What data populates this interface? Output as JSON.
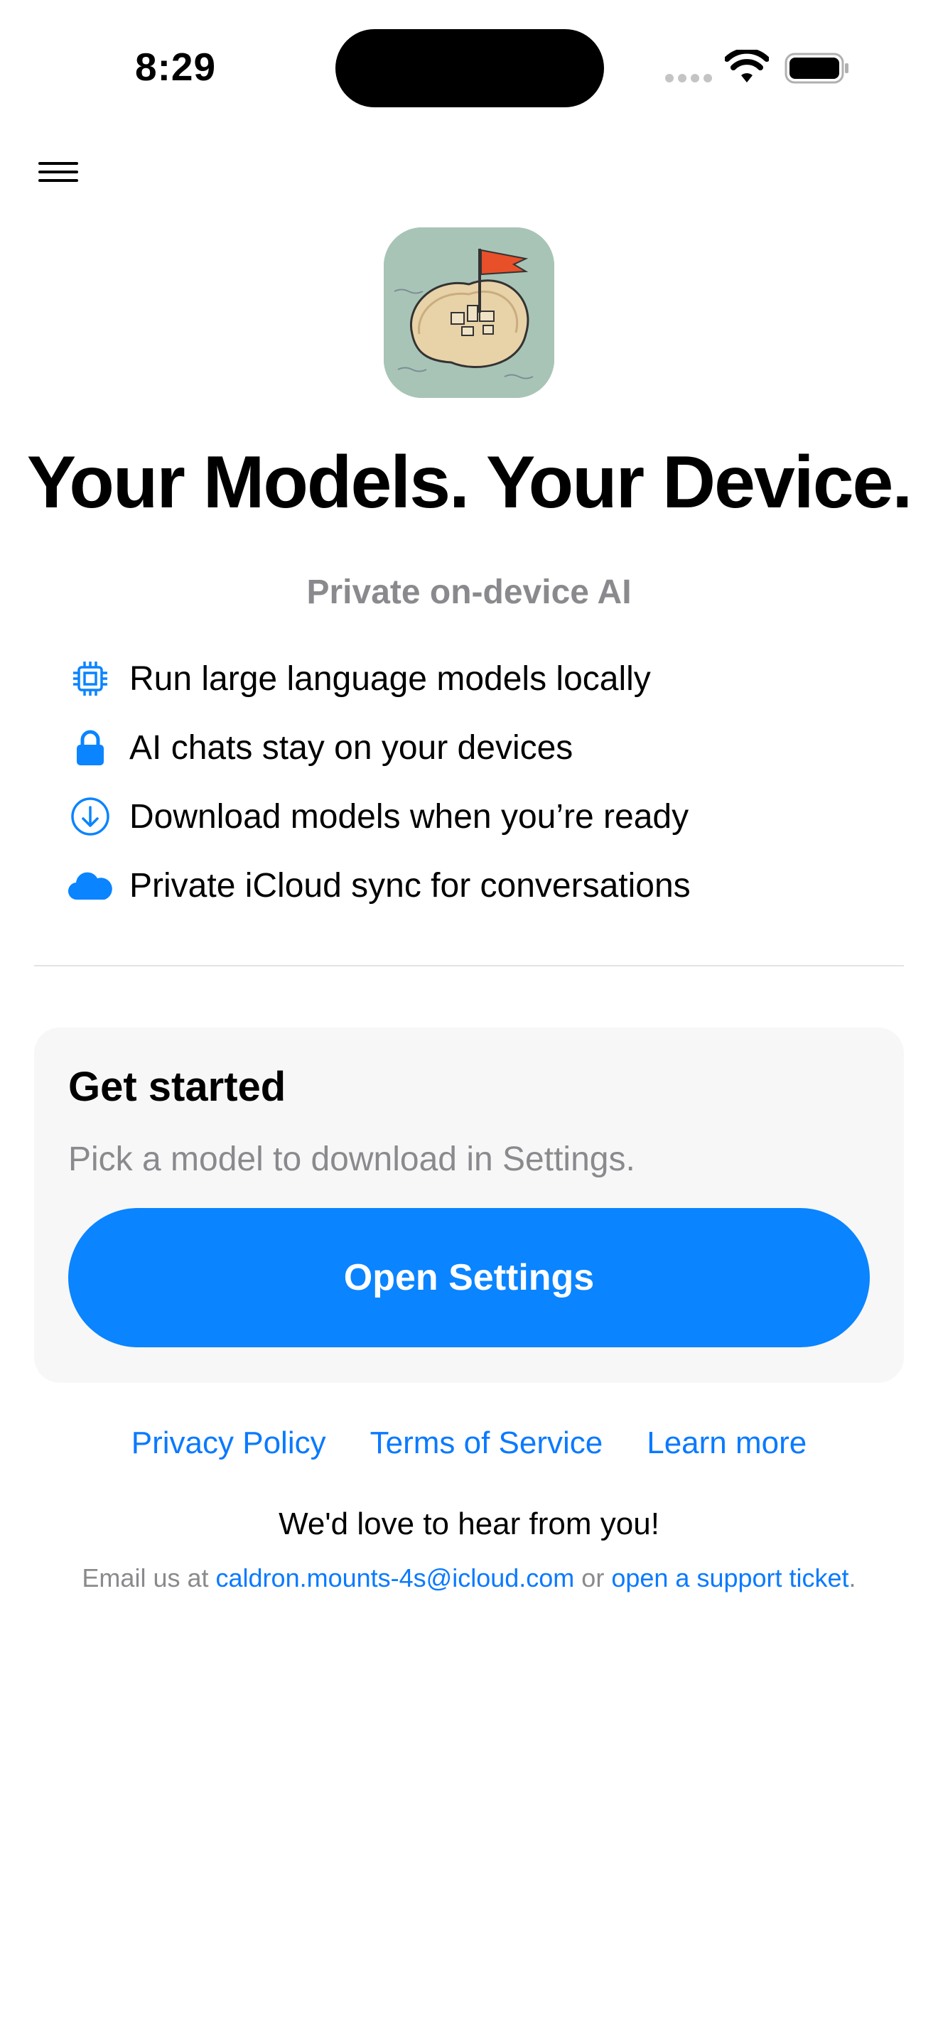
{
  "status_bar": {
    "time": "8:29"
  },
  "header": {
    "menu_icon": "hamburger-menu-icon"
  },
  "hero": {
    "app_icon": "island-flag-app-icon",
    "headline": "Your Models. Your Device.",
    "subtitle": "Private on-device AI"
  },
  "features": [
    {
      "icon": "cpu-chip-icon",
      "label": "Run large language models locally"
    },
    {
      "icon": "lock-icon",
      "label": "AI chats stay on your devices"
    },
    {
      "icon": "download-circle-icon",
      "label": "Download models when you’re ready"
    },
    {
      "icon": "cloud-icon",
      "label": "Private iCloud sync for conversations"
    }
  ],
  "get_started": {
    "title": "Get started",
    "description": "Pick a model to download in Settings.",
    "button_label": "Open Settings"
  },
  "links": {
    "privacy": "Privacy Policy",
    "terms": "Terms of Service",
    "learn_more": "Learn more"
  },
  "contact": {
    "heading": "We'd love to hear from you!",
    "prefix": "Email us at",
    "email": "caldron.mounts-4s@icloud.com",
    "middle": "or",
    "ticket_link": "open a support ticket",
    "suffix": "."
  },
  "colors": {
    "accent": "#0a84ff",
    "link": "#0a7aff",
    "secondary_text": "#8a8a8e"
  }
}
